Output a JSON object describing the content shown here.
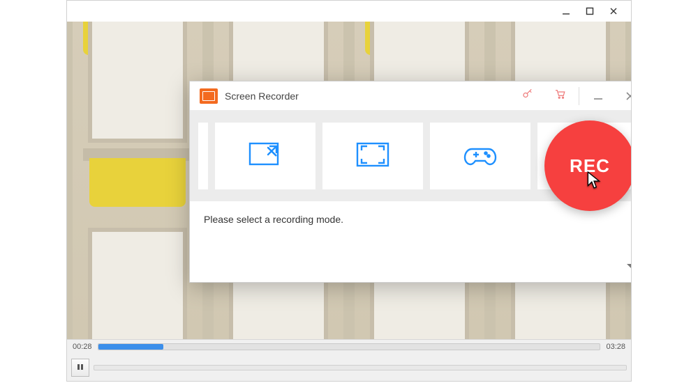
{
  "player": {
    "time_current": "00:28",
    "time_total": "03:28",
    "progress_percent": 13
  },
  "recorder": {
    "title": "Screen Recorder",
    "rec_button_label": "REC",
    "hint": "Please select a recording mode."
  }
}
